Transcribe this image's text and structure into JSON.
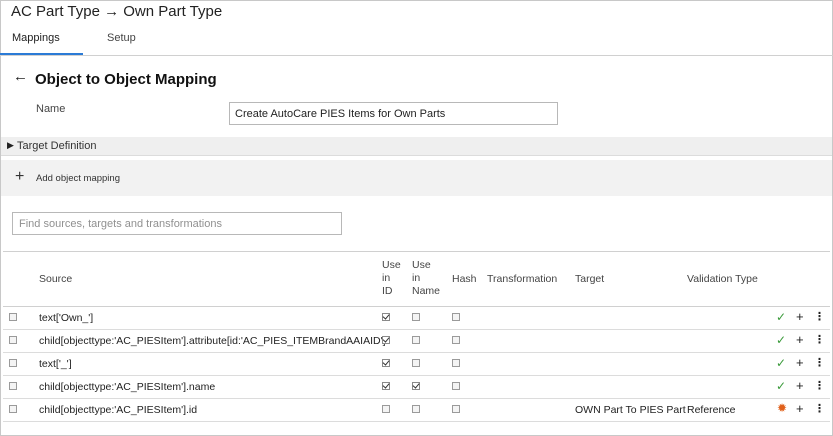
{
  "app": {
    "title": "AC Part Type → Own Part Type"
  },
  "tabs": [
    {
      "label": "Mappings",
      "active": true
    },
    {
      "label": "Setup",
      "active": false
    }
  ],
  "section": {
    "title": "Object to Object Mapping",
    "back_icon": "arrow-left-icon"
  },
  "name_field": {
    "label": "Name",
    "value": "Create AutoCare PIES Items for Own Parts"
  },
  "target_definition": {
    "label": "Target Definition",
    "expanded": false
  },
  "add_mapping": {
    "label": "Add object mapping"
  },
  "search": {
    "placeholder": "Find sources, targets and transformations",
    "value": ""
  },
  "table": {
    "headers": {
      "source": "Source",
      "use_in_id": [
        "Use",
        "in",
        "ID"
      ],
      "use_in_name": [
        "Use",
        "in",
        "Name"
      ],
      "hash": "Hash",
      "transformation": "Transformation",
      "target": "Target",
      "validation_type": "Validation Type"
    },
    "rows": [
      {
        "source": "text['Own_']",
        "use_in_id": true,
        "use_in_name": false,
        "hash": false,
        "transformation": "",
        "target": "",
        "validation_type": "",
        "status": "ok",
        "status_icon": "check-icon"
      },
      {
        "source": "child[objecttype:'AC_PIESItem'].attribute[id:'AC_PIES_ITEMBrandAAIAID']",
        "use_in_id": true,
        "use_in_name": false,
        "hash": false,
        "transformation": "",
        "target": "",
        "validation_type": "",
        "status": "ok",
        "status_icon": "check-icon"
      },
      {
        "source": "text['_']",
        "use_in_id": true,
        "use_in_name": false,
        "hash": false,
        "transformation": "",
        "target": "",
        "validation_type": "",
        "status": "ok",
        "status_icon": "check-icon"
      },
      {
        "source": "child[objecttype:'AC_PIESItem'].name",
        "use_in_id": true,
        "use_in_name": true,
        "hash": false,
        "transformation": "",
        "target": "",
        "validation_type": "",
        "status": "ok",
        "status_icon": "check-icon"
      },
      {
        "source": "child[objecttype:'AC_PIESItem'].id",
        "use_in_id": false,
        "use_in_name": false,
        "hash": false,
        "transformation": "",
        "target": "OWN Part To PIES Part",
        "validation_type": "Reference",
        "status": "warning",
        "status_icon": "gear-warning-icon"
      }
    ]
  },
  "colors": {
    "accent": "#2b7bd6",
    "ok": "#3a9a3a",
    "warning": "#e0601a"
  }
}
